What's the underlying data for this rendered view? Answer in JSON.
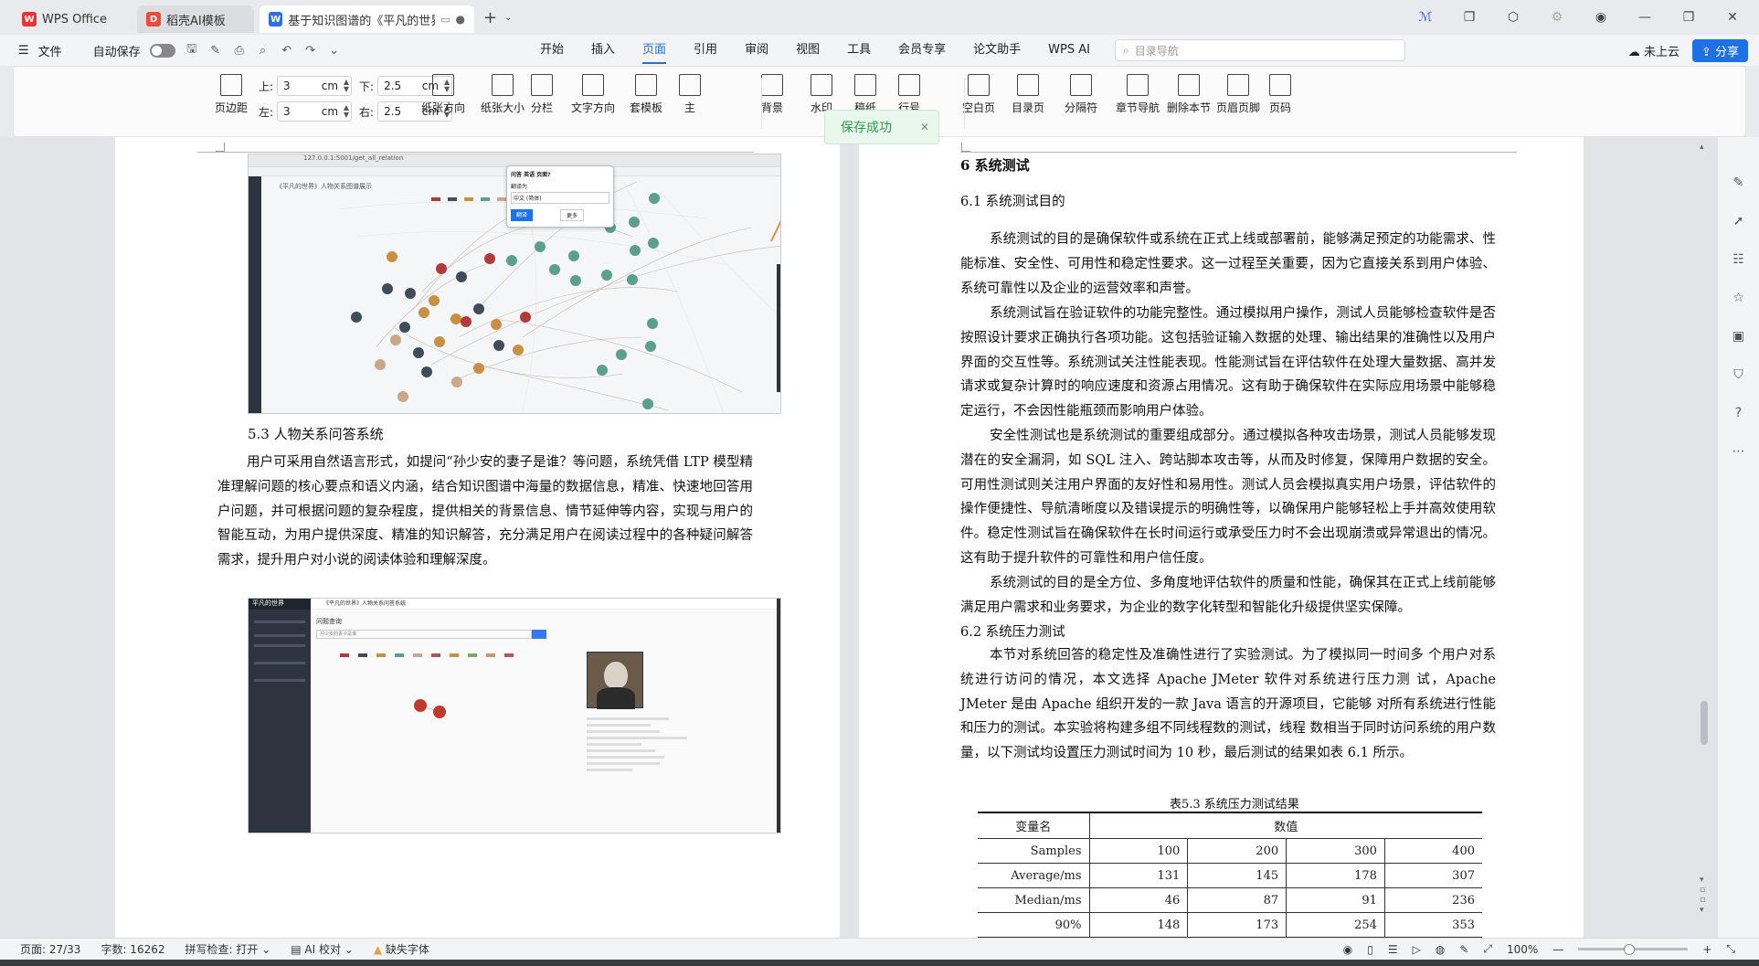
{
  "tabs": [
    {
      "label": "WPS Office",
      "icon": "wps-icon",
      "color": "#e33"
    },
    {
      "label": "稻壳AI模板",
      "icon": "docer-icon",
      "color": "#e94b3c"
    },
    {
      "label": "基于知识图谱的《平凡的世界",
      "icon": "writer-icon",
      "color": "#2e6fe0"
    }
  ],
  "menubar": {
    "file_label": "文件",
    "autosave_label": "自动保存",
    "menus": [
      "开始",
      "插入",
      "页面",
      "引用",
      "审阅",
      "视图",
      "工具",
      "会员专享",
      "论文助手",
      "WPS AI"
    ],
    "active_menu": "页面",
    "search_placeholder": "目录导航",
    "cloud_label": "未上云",
    "share_label": "分享"
  },
  "ribbon": {
    "margin_label": "页边距",
    "top_label": "上:",
    "top_value": "3",
    "bottom_label": "下:",
    "bottom_value": "2.5",
    "left_label": "左:",
    "left_value": "3",
    "right_label": "右:",
    "right_value": "2.5",
    "unit": "cm",
    "buttons": [
      "纸张方向",
      "纸张大小",
      "分栏",
      "文字方向",
      "套模板",
      "主",
      "背景",
      "水印",
      "稿纸",
      "行号",
      "空白页",
      "目录页",
      "分隔符",
      "章节导航",
      "删除本节",
      "页眉页脚",
      "页码"
    ]
  },
  "toast": {
    "text": "保存成功"
  },
  "left_page": {
    "section_title": "5.3 人物关系问答系统",
    "paragraph": "用户可采用自然语言形式，如提问“孙少安的妻子是谁？等问题，系统凭借 LTP 模型精准理解问题的核心要点和语义内涵，结合知识图谱中海量的数据信息，精准、快速地回答用户问题，并可根据问题的复杂程度，提供相关的背景信息、情节延伸等内容，实现与用户的智能互动，为用户提供深度、精准的知识解答，充分满足用户在阅读过程中的各种疑问解答需求，提升用户对小说的阅读体验和理解深度。",
    "shot1_title": "《平凡的世界》人物关系图谱展示",
    "shot1_url": "127.0.0.1:5001/get_all_relation",
    "shot1_dialog": {
      "title": "问答 英语 页面?",
      "label": "翻译为",
      "select": "中文 (简体)",
      "ok": "翻译",
      "more": "更多"
    },
    "shot2_sidebar_title": "平凡的世界",
    "shot2_header": "《平凡的世界》人物关系问答系统",
    "shot2_subtitle": "问题查询",
    "shot2_input": "孙少安的妻子是谁"
  },
  "right_page": {
    "chapter": "6  系统测试",
    "sec61": "6.1  系统测试目的",
    "p1": "系统测试的目的是确保软件或系统在正式上线或部署前，能够满足预定的功能需求、性能标准、安全性、可用性和稳定性要求。这一过程至关重要，因为它直接关系到用户体验、系统可靠性以及企业的运营效率和声誉。",
    "p2": "系统测试旨在验证软件的功能完整性。通过模拟用户操作，测试人员能够检查软件是否按照设计要求正确执行各项功能。这包括验证输入数据的处理、输出结果的准确性以及用户界面的交互性等。系统测试关注性能表现。性能测试旨在评估软件在处理大量数据、高并发请求或复杂计算时的响应速度和资源占用情况。这有助于确保软件在实际应用场景中能够稳定运行，不会因性能瓶颈而影响用户体验。",
    "p3": "安全性测试也是系统测试的重要组成部分。通过模拟各种攻击场景，测试人员能够发现潜在的安全漏洞，如 SQL 注入、跨站脚本攻击等，从而及时修复，保障用户数据的安全。可用性测试则关注用户界面的友好性和易用性。测试人员会模拟真实用户场景，评估软件的操作便捷性、导航清晰度以及错误提示的明确性等，以确保用户能够轻松上手并高效使用软件。稳定性测试旨在确保软件在长时间运行或承受压力时不会出现崩溃或异常退出的情况。这有助于提升软件的可靠性和用户信任度。",
    "p4": "系统测试的目的是全方位、多角度地评估软件的质量和性能，确保其在正式上线前能够满足用户需求和业务要求，为企业的数字化转型和智能化升级提供坚实保障。",
    "sec62": "6.2  系统压力测试",
    "p5": "本节对系统回答的稳定性及准确性进行了实验测试。为了模拟同一时间多 个用户对系统进行访问的情况，本文选择 Apache JMeter 软件对系统进行压力测 试，Apache JMeter 是由 Apache 组织开发的一款 Java 语言的开源项目，它能够 对所有系统进行性能和压力的测试。本实验将构建多组不同线程数的测试，线程 数相当于同时访问系统的用户数量，以下测试均设置压力测试时间为 10 秒，最后测试的结果如表 6.1 所示。",
    "table_caption": "表5.3   系统压力测试结果",
    "table": {
      "h1": "变量名",
      "h2": "数值",
      "rows": [
        [
          "Samples",
          "100",
          "200",
          "300",
          "400"
        ],
        [
          "Average/ms",
          "131",
          "145",
          "178",
          "307"
        ],
        [
          "Median/ms",
          "46",
          "87",
          "91",
          "236"
        ],
        [
          "90%",
          "148",
          "173",
          "254",
          "353"
        ]
      ]
    }
  },
  "status": {
    "page": "页面: 27/33",
    "words": "字数: 16262",
    "spell": "拼写检查: 打开",
    "ai": "AI 校对",
    "missing_font": "缺失字体",
    "zoom": "100%"
  }
}
